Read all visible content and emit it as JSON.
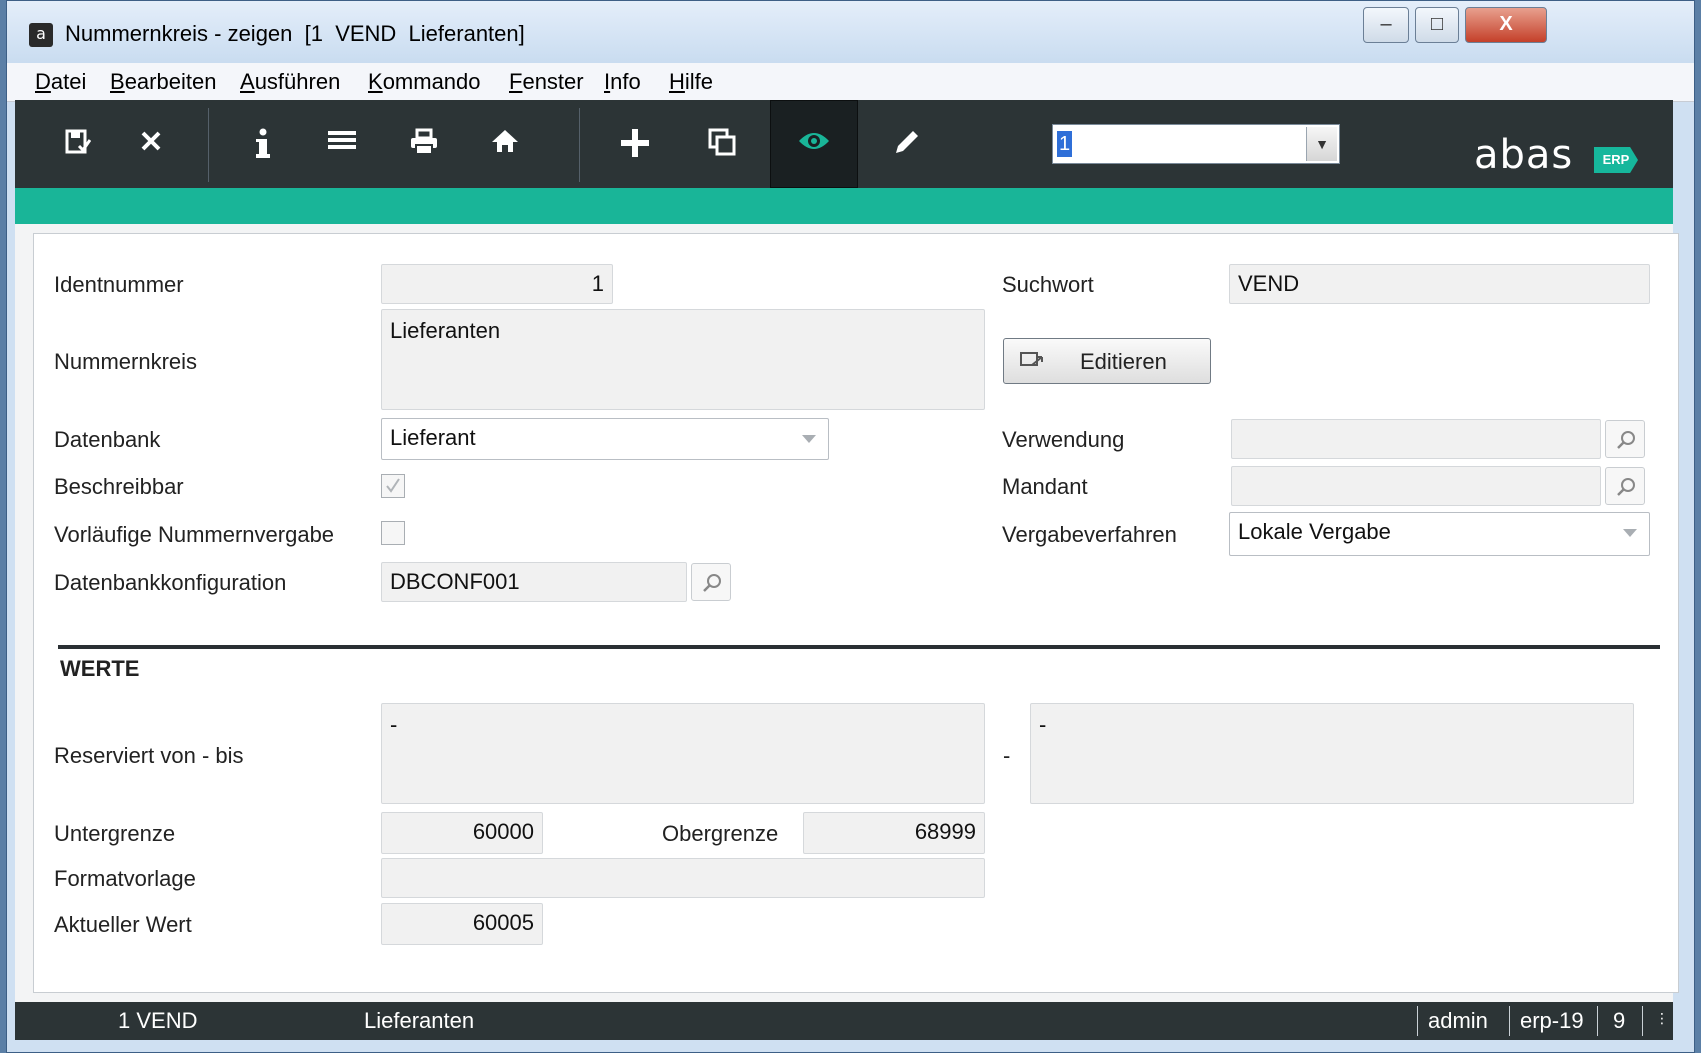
{
  "window": {
    "title": "Nummernkreis - zeigen  [1  VEND  Lieferanten]",
    "app_icon": "a",
    "buttons": {
      "minimize": "–",
      "maximize": "□",
      "close": "X"
    }
  },
  "menu": [
    {
      "hot": "D",
      "rest": "atei"
    },
    {
      "hot": "B",
      "rest": "earbeiten"
    },
    {
      "hot": "A",
      "rest": "usführen"
    },
    {
      "hot": "K",
      "rest": "ommando"
    },
    {
      "hot": "F",
      "rest": "enster"
    },
    {
      "hot": "I",
      "rest": "nfo"
    },
    {
      "hot": "H",
      "rest": "ilfe"
    }
  ],
  "toolbar": {
    "icons": [
      "save-icon",
      "close-icon",
      "info-icon",
      "list-icon",
      "print-icon",
      "home-icon",
      "add-icon",
      "copy-icon",
      "view-icon",
      "edit-icon"
    ],
    "active": "view-icon",
    "combo_value": "1",
    "logo_text": "abas",
    "logo_badge": "ERP"
  },
  "form": {
    "identnummer": {
      "label": "Identnummer",
      "value": "1"
    },
    "suchwort": {
      "label": "Suchwort",
      "value": "VEND"
    },
    "nummernkreis": {
      "label": "Nummernkreis",
      "value": "Lieferanten"
    },
    "edit_button": "Editieren",
    "datenbank": {
      "label": "Datenbank",
      "value": "Lieferant"
    },
    "verwendung": {
      "label": "Verwendung",
      "value": ""
    },
    "beschreibbar": {
      "label": "Beschreibbar",
      "checked": true
    },
    "mandant": {
      "label": "Mandant",
      "value": ""
    },
    "vorlaeufig": {
      "label": "Vorläufige Nummernvergabe",
      "checked": false
    },
    "vergabeverfahren": {
      "label": "Vergabeverfahren",
      "value": "Lokale Vergabe"
    },
    "dbconfig": {
      "label": "Datenbankkonfiguration",
      "value": "DBCONF001"
    }
  },
  "werte": {
    "heading": "WERTE",
    "reserviert": {
      "label": "Reserviert von - bis",
      "from": "-",
      "separator": "-",
      "to": "-"
    },
    "untergrenze": {
      "label": "Untergrenze",
      "value": "60000"
    },
    "obergrenze": {
      "label": "Obergrenze",
      "value": "68999"
    },
    "formatvorlage": {
      "label": "Formatvorlage",
      "value": ""
    },
    "aktueller_wert": {
      "label": "Aktueller Wert",
      "value": "60005"
    }
  },
  "status": {
    "record": "1 VEND",
    "name": "Lieferanten",
    "user": "admin",
    "server": "erp-19",
    "count": "9"
  }
}
